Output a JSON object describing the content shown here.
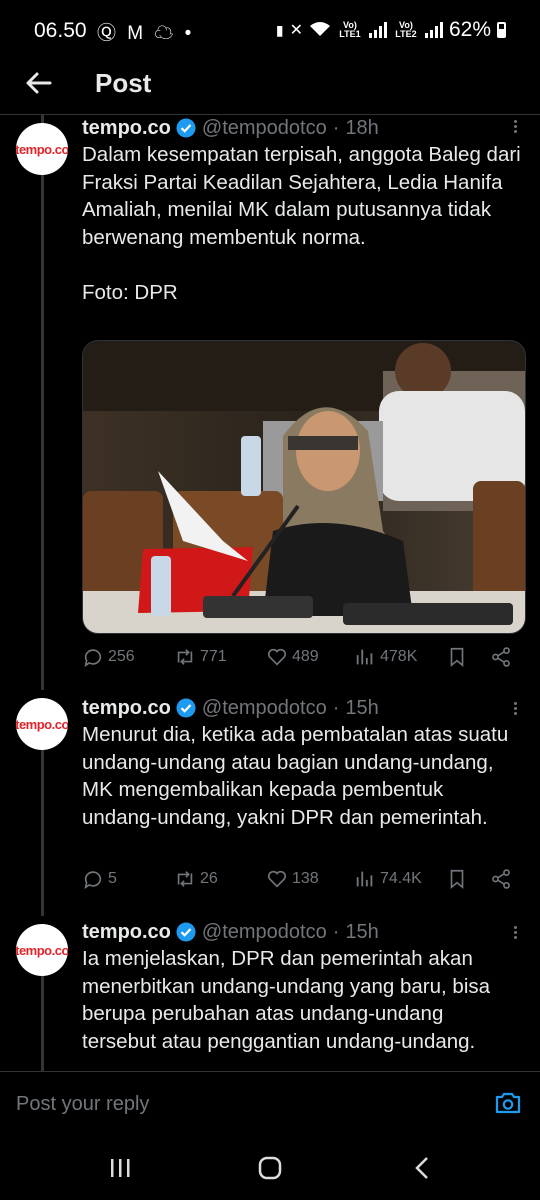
{
  "status_bar": {
    "time": "06.50",
    "left_icons": "Ⓠ M ☁ •",
    "volte1": "Vo) LTE1",
    "volte2": "Vo) LTE2",
    "battery": "62%"
  },
  "header": {
    "title": "Post"
  },
  "tweets": [
    {
      "name": "tempo.co",
      "handle": "@tempodotco",
      "time": "18h",
      "avatar_text": "tempo.co",
      "text": "Dalam kesempatan terpisah, anggota Baleg dari Fraksi Partai Keadilan Sejahtera, Ledia Hanifa Amaliah, menilai MK dalam putusannya tidak berwenang membentuk norma.\n\nFoto: DPR",
      "replies": "256",
      "reposts": "771",
      "likes": "489",
      "views": "478K"
    },
    {
      "name": "tempo.co",
      "handle": "@tempodotco",
      "time": "15h",
      "avatar_text": "tempo.co",
      "text": "Menurut dia, ketika ada pembatalan atas suatu undang-undang atau bagian undang-undang, MK mengembalikan kepada pembentuk undang-undang, yakni DPR dan pemerintah.",
      "replies": "5",
      "reposts": "26",
      "likes": "138",
      "views": "74.4K"
    },
    {
      "name": "tempo.co",
      "handle": "@tempodotco",
      "time": "15h",
      "avatar_text": "tempo.co",
      "text": "Ia menjelaskan, DPR dan pemerintah akan menerbitkan undang-undang yang baru, bisa berupa perubahan atas undang-undang tersebut atau penggantian undang-undang."
    }
  ],
  "reply_bar": {
    "placeholder": "Post your reply"
  },
  "colors": {
    "accent": "#1d9bf0",
    "brand_red": "#e2242a",
    "muted": "#71767b"
  }
}
